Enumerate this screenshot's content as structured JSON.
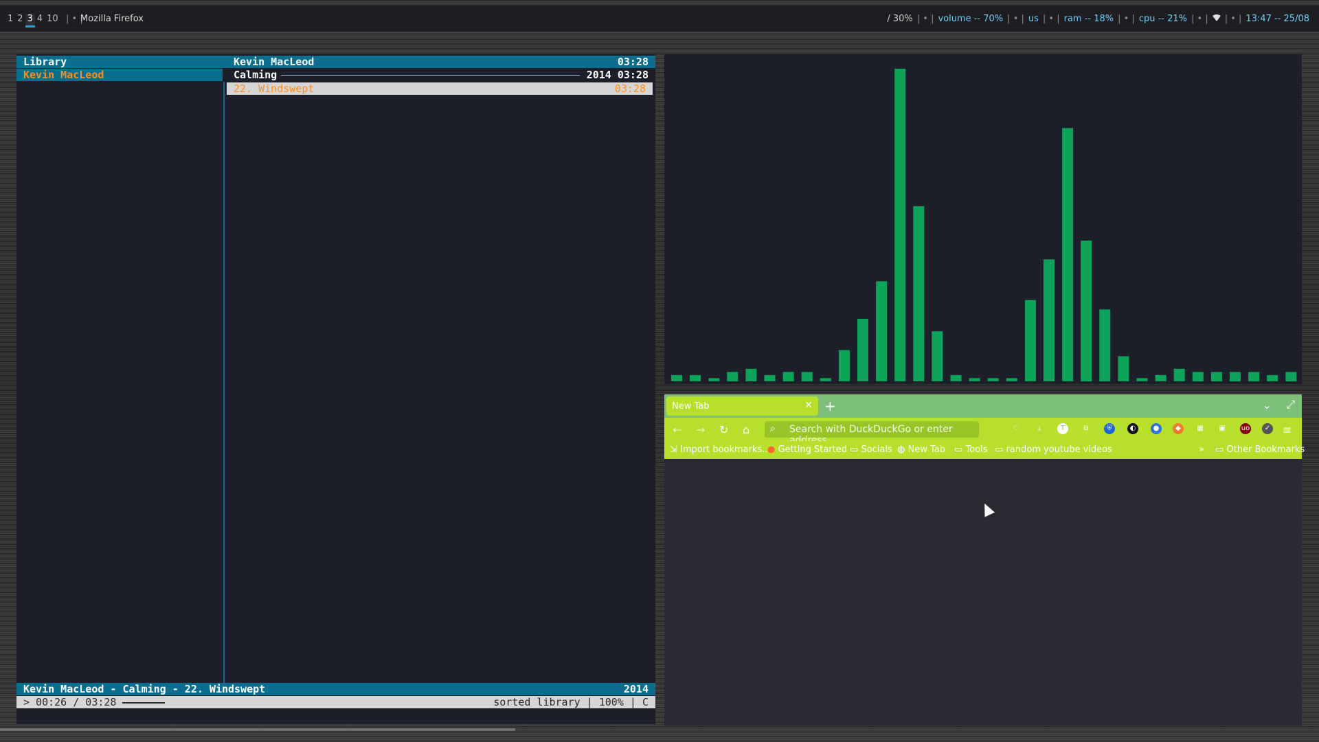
{
  "topbar": {
    "workspaces": [
      "1",
      "2",
      "3",
      "4",
      "10"
    ],
    "active_workspace": "3",
    "separator": "| • |",
    "window_title": "Mozilla Firefox",
    "status": {
      "disk": "/ 30%",
      "volume": "volume -- 70%",
      "keyboard": "us",
      "ram": "ram -- 18%",
      "cpu": "cpu -- 21%",
      "clock": "13:47 -- 25/08"
    }
  },
  "cmus": {
    "header_left": "Library",
    "header_artist": "Kevin MacLeod",
    "header_time": "03:28",
    "library_selected": "Kevin MacLeod",
    "album_name": "Calming",
    "album_meta": "2014 03:28",
    "track_name": "22. Windswept",
    "track_duration": "03:28",
    "now_playing": "Kevin MacLeod - Calming - 22. Windswept",
    "now_playing_year": "2014",
    "position": "> 00:26 / 03:28",
    "status_right": "sorted library | 100% | C"
  },
  "visualizer": {
    "bar_color": "#0ea35a",
    "levels": [
      2,
      2,
      1,
      3,
      4,
      2,
      3,
      3,
      1,
      10,
      20,
      32,
      100,
      56,
      16,
      2,
      1,
      1,
      1,
      26,
      39,
      81,
      45,
      23,
      8,
      1,
      2,
      4,
      3,
      3,
      3,
      3,
      2,
      3,
      1
    ]
  },
  "firefox": {
    "tab_title": "New Tab",
    "url_placeholder": "Search with DuckDuckGo or enter address",
    "bookmarks": [
      "Import bookmarks...",
      "Getting Started",
      "Socials",
      "New Tab",
      "Tools",
      "random youtube videos"
    ],
    "other_bookmarks": "Other Bookmarks",
    "colors": {
      "tabbar": "#7dc07a",
      "toolbar": "#b6e02c",
      "content": "#2b2a33"
    }
  }
}
